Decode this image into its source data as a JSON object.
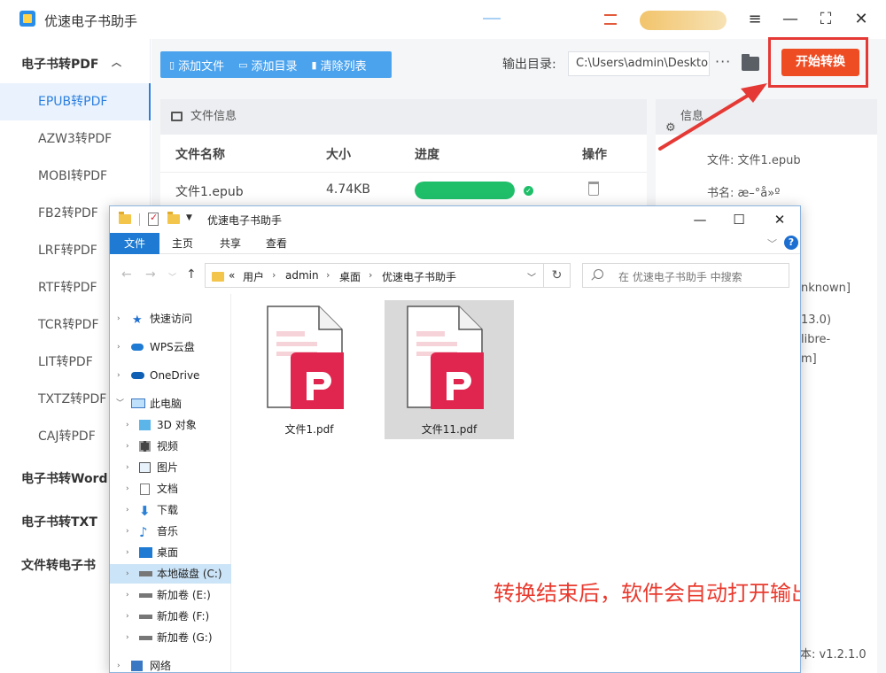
{
  "app": {
    "title": "优速电子书助手",
    "window_buttons": {
      "menu": "≡",
      "minimize": "—",
      "maximize": "⛶",
      "close": "✕"
    }
  },
  "sidebar": {
    "groups": [
      {
        "label": "电子书转PDF",
        "expanded": true
      },
      {
        "label": "电子书转Word"
      },
      {
        "label": "电子书转TXT"
      },
      {
        "label": "文件转电子书"
      }
    ],
    "items": [
      "EPUB转PDF",
      "AZW3转PDF",
      "MOBI转PDF",
      "FB2转PDF",
      "LRF转PDF",
      "RTF转PDF",
      "TCR转PDF",
      "LIT转PDF",
      "TXTZ转PDF",
      "CAJ转PDF"
    ],
    "active_item": "EPUB转PDF"
  },
  "toolbar": {
    "add_file": "添加文件",
    "add_dir": "添加目录",
    "clear_list": "清除列表",
    "output_label": "输出目录:",
    "output_path": "C:\\Users\\admin\\Desktop",
    "more": "···",
    "start": "开始转换"
  },
  "file_panel": {
    "title": "文件信息",
    "columns": [
      "文件名称",
      "大小",
      "进度",
      "操作"
    ],
    "rows": [
      {
        "name": "文件1.epub",
        "size": "4.74KB",
        "progress": 1.0
      }
    ]
  },
  "info_panel": {
    "title": "信息",
    "file_line": "文件:  文件1.epub",
    "title_line": "书名:  æ–°å»º",
    "frag_1": "nknown]",
    "frag_2": "13.0)",
    "frag_3": "libre-",
    "frag_4": "m]",
    "version": "本: v1.2.1.0"
  },
  "explorer": {
    "title": "优速电子书助手",
    "ribbon_tabs": [
      "文件",
      "主页",
      "共享",
      "查看"
    ],
    "address": {
      "prefix": "«",
      "segments": [
        "用户",
        "admin",
        "桌面",
        "优速电子书助手"
      ]
    },
    "search_placeholder": "在 优速电子书助手 中搜索",
    "nav": [
      {
        "label": "快速访问",
        "icon": "star-icon"
      },
      {
        "label": "WPS云盘",
        "icon": "cloud-icon"
      },
      {
        "label": "OneDrive",
        "icon": "cloud-icon"
      },
      {
        "label": "此电脑",
        "icon": "computer-icon"
      },
      {
        "label": "3D 对象",
        "icon": "cube-icon"
      },
      {
        "label": "视频",
        "icon": "video-icon"
      },
      {
        "label": "图片",
        "icon": "picture-icon"
      },
      {
        "label": "文档",
        "icon": "document-icon"
      },
      {
        "label": "下载",
        "icon": "download-icon"
      },
      {
        "label": "音乐",
        "icon": "music-icon"
      },
      {
        "label": "桌面",
        "icon": "desktop-icon"
      },
      {
        "label": "本地磁盘 (C:)",
        "icon": "drive-icon"
      },
      {
        "label": "新加卷 (E:)",
        "icon": "drive-icon"
      },
      {
        "label": "新加卷 (F:)",
        "icon": "drive-icon"
      },
      {
        "label": "新加卷 (G:)",
        "icon": "drive-icon"
      },
      {
        "label": "网络",
        "icon": "network-icon"
      }
    ],
    "files": [
      {
        "name": "文件1.pdf",
        "selected": false
      },
      {
        "name": "文件11.pdf",
        "selected": true
      }
    ]
  },
  "annotation": "转换结束后，软件会自动打开输出文件夹",
  "colors": {
    "accent": "#2c7fe0",
    "toolbar": "#4ba3ee",
    "start_button": "#ee4d24",
    "progress": "#1fbf6a",
    "annotation": "#e93a2e",
    "pdf_red": "#e0254f"
  }
}
